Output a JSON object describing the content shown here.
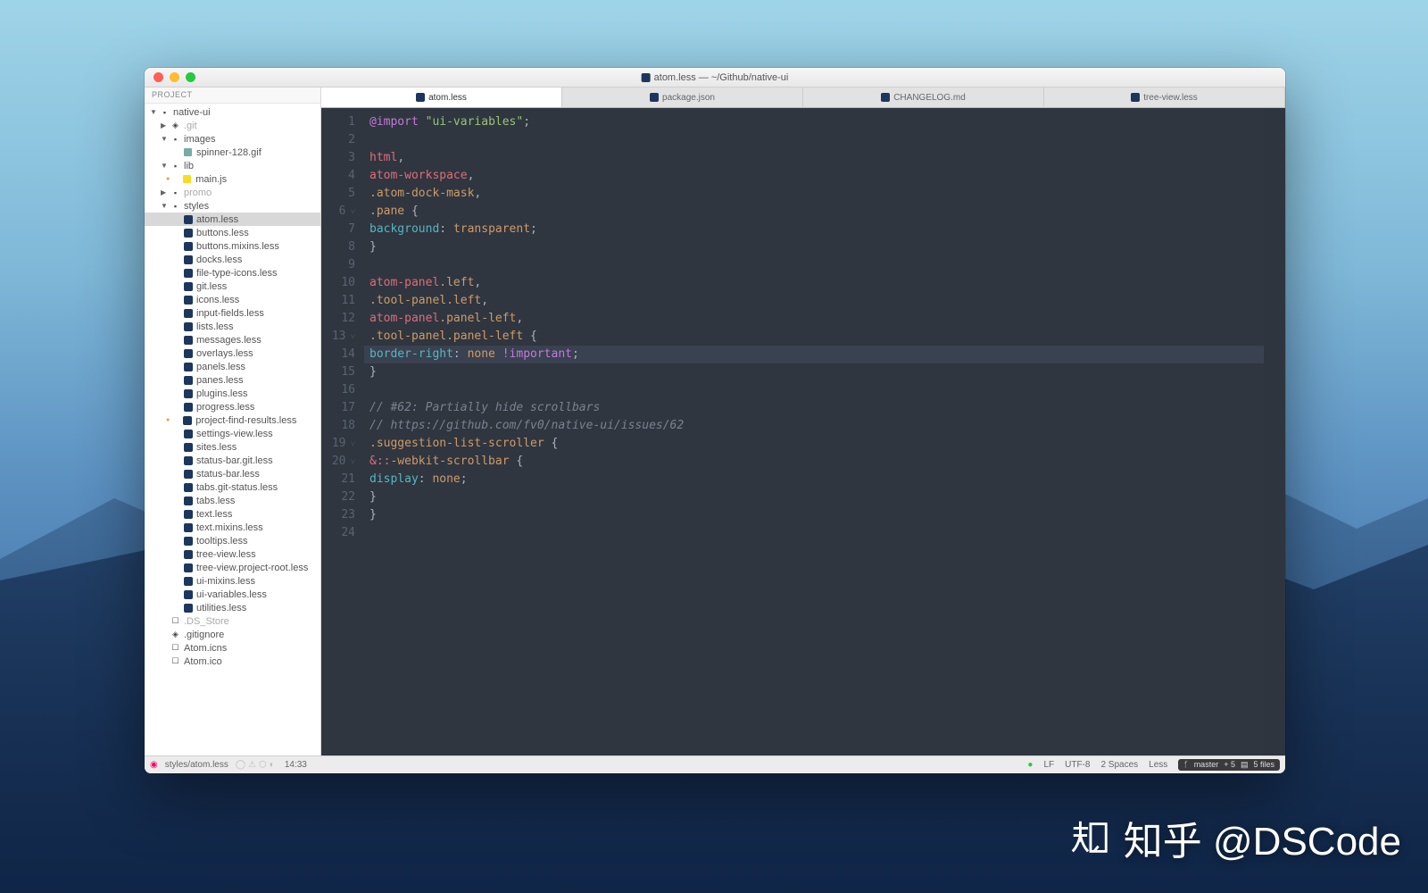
{
  "titlebar": {
    "title": "atom.less — ~/Github/native-ui"
  },
  "sidebar": {
    "header": "PROJECT",
    "tree": [
      {
        "lbl": "native-ui",
        "depth": 0,
        "exp": true,
        "kind": "folder"
      },
      {
        "lbl": ".git",
        "depth": 1,
        "exp": false,
        "kind": "git",
        "faded": true
      },
      {
        "lbl": "images",
        "depth": 1,
        "exp": true,
        "kind": "folder"
      },
      {
        "lbl": "spinner-128.gif",
        "depth": 2,
        "kind": "image"
      },
      {
        "lbl": "lib",
        "depth": 1,
        "exp": true,
        "kind": "folder"
      },
      {
        "lbl": "main.js",
        "depth": 2,
        "kind": "js",
        "mod": true
      },
      {
        "lbl": "promo",
        "depth": 1,
        "exp": false,
        "kind": "folder",
        "faded": true
      },
      {
        "lbl": "styles",
        "depth": 1,
        "exp": true,
        "kind": "folder"
      },
      {
        "lbl": "atom.less",
        "depth": 2,
        "kind": "less",
        "selected": true
      },
      {
        "lbl": "buttons.less",
        "depth": 2,
        "kind": "less"
      },
      {
        "lbl": "buttons.mixins.less",
        "depth": 2,
        "kind": "less"
      },
      {
        "lbl": "docks.less",
        "depth": 2,
        "kind": "less"
      },
      {
        "lbl": "file-type-icons.less",
        "depth": 2,
        "kind": "less"
      },
      {
        "lbl": "git.less",
        "depth": 2,
        "kind": "less"
      },
      {
        "lbl": "icons.less",
        "depth": 2,
        "kind": "less"
      },
      {
        "lbl": "input-fields.less",
        "depth": 2,
        "kind": "less"
      },
      {
        "lbl": "lists.less",
        "depth": 2,
        "kind": "less"
      },
      {
        "lbl": "messages.less",
        "depth": 2,
        "kind": "less"
      },
      {
        "lbl": "overlays.less",
        "depth": 2,
        "kind": "less"
      },
      {
        "lbl": "panels.less",
        "depth": 2,
        "kind": "less"
      },
      {
        "lbl": "panes.less",
        "depth": 2,
        "kind": "less"
      },
      {
        "lbl": "plugins.less",
        "depth": 2,
        "kind": "less"
      },
      {
        "lbl": "progress.less",
        "depth": 2,
        "kind": "less"
      },
      {
        "lbl": "project-find-results.less",
        "depth": 2,
        "kind": "less",
        "mod": true
      },
      {
        "lbl": "settings-view.less",
        "depth": 2,
        "kind": "less"
      },
      {
        "lbl": "sites.less",
        "depth": 2,
        "kind": "less"
      },
      {
        "lbl": "status-bar.git.less",
        "depth": 2,
        "kind": "less"
      },
      {
        "lbl": "status-bar.less",
        "depth": 2,
        "kind": "less"
      },
      {
        "lbl": "tabs.git-status.less",
        "depth": 2,
        "kind": "less"
      },
      {
        "lbl": "tabs.less",
        "depth": 2,
        "kind": "less"
      },
      {
        "lbl": "text.less",
        "depth": 2,
        "kind": "less"
      },
      {
        "lbl": "text.mixins.less",
        "depth": 2,
        "kind": "less"
      },
      {
        "lbl": "tooltips.less",
        "depth": 2,
        "kind": "less"
      },
      {
        "lbl": "tree-view.less",
        "depth": 2,
        "kind": "less"
      },
      {
        "lbl": "tree-view.project-root.less",
        "depth": 2,
        "kind": "less"
      },
      {
        "lbl": "ui-mixins.less",
        "depth": 2,
        "kind": "less"
      },
      {
        "lbl": "ui-variables.less",
        "depth": 2,
        "kind": "less"
      },
      {
        "lbl": "utilities.less",
        "depth": 2,
        "kind": "less"
      },
      {
        "lbl": ".DS_Store",
        "depth": 1,
        "kind": "file",
        "faded": true
      },
      {
        "lbl": ".gitignore",
        "depth": 1,
        "kind": "git"
      },
      {
        "lbl": "Atom.icns",
        "depth": 1,
        "kind": "file"
      },
      {
        "lbl": "Atom.ico",
        "depth": 1,
        "kind": "file"
      }
    ]
  },
  "tabs": [
    {
      "label": "atom.less",
      "active": true,
      "icon": "less"
    },
    {
      "label": "package.json",
      "active": false,
      "icon": "json"
    },
    {
      "label": "CHANGELOG.md",
      "active": false,
      "icon": "md"
    },
    {
      "label": "tree-view.less",
      "active": false,
      "icon": "less"
    }
  ],
  "code": {
    "highlight_line": 14,
    "fold_lines": [
      6,
      13,
      19,
      20
    ],
    "lines": [
      [
        {
          "t": "@import",
          "c": "kw"
        },
        {
          "t": " ",
          "c": "pn"
        },
        {
          "t": "\"ui-variables\"",
          "c": "str"
        },
        {
          "t": ";",
          "c": "pn"
        }
      ],
      [],
      [
        {
          "t": "html",
          "c": "tag"
        },
        {
          "t": ",",
          "c": "pn"
        }
      ],
      [
        {
          "t": "atom-workspace",
          "c": "tag"
        },
        {
          "t": ",",
          "c": "pn"
        }
      ],
      [
        {
          "t": ".atom-dock-mask",
          "c": "cls"
        },
        {
          "t": ",",
          "c": "pn"
        }
      ],
      [
        {
          "t": ".pane",
          "c": "cls"
        },
        {
          "t": " {",
          "c": "pn"
        }
      ],
      [
        {
          "t": "  background",
          "c": "prop"
        },
        {
          "t": ": ",
          "c": "pn"
        },
        {
          "t": "transparent",
          "c": "val"
        },
        {
          "t": ";",
          "c": "pn"
        }
      ],
      [
        {
          "t": "}",
          "c": "pn"
        }
      ],
      [],
      [
        {
          "t": "atom-panel",
          "c": "tag"
        },
        {
          "t": ".left",
          "c": "cls"
        },
        {
          "t": ",",
          "c": "pn"
        }
      ],
      [
        {
          "t": ".tool-panel",
          "c": "cls"
        },
        {
          "t": ".left",
          "c": "cls"
        },
        {
          "t": ",",
          "c": "pn"
        }
      ],
      [
        {
          "t": "atom-panel",
          "c": "tag"
        },
        {
          "t": ".panel-left",
          "c": "cls"
        },
        {
          "t": ",",
          "c": "pn"
        }
      ],
      [
        {
          "t": ".tool-panel",
          "c": "cls"
        },
        {
          "t": ".panel-left",
          "c": "cls"
        },
        {
          "t": " {",
          "c": "pn"
        }
      ],
      [
        {
          "t": "  border-right",
          "c": "prop"
        },
        {
          "t": ": ",
          "c": "pn"
        },
        {
          "t": "none",
          "c": "val"
        },
        {
          "t": " !important",
          "c": "imp"
        },
        {
          "t": ";",
          "c": "pn"
        }
      ],
      [
        {
          "t": "}",
          "c": "pn"
        }
      ],
      [],
      [
        {
          "t": "// #62: Partially hide scrollbars",
          "c": "cm"
        }
      ],
      [
        {
          "t": "// https://github.com/fv0/native-ui/issues/62",
          "c": "cm"
        }
      ],
      [
        {
          "t": ".suggestion-list-scroller",
          "c": "cls"
        },
        {
          "t": " {",
          "c": "pn"
        }
      ],
      [
        {
          "t": "  &::",
          "c": "tag"
        },
        {
          "t": "-webkit-scrollbar",
          "c": "cls"
        },
        {
          "t": " {",
          "c": "pn"
        }
      ],
      [
        {
          "t": "    display",
          "c": "prop"
        },
        {
          "t": ": ",
          "c": "pn"
        },
        {
          "t": "none",
          "c": "val"
        },
        {
          "t": ";",
          "c": "pn"
        }
      ],
      [
        {
          "t": "  }",
          "c": "pn"
        }
      ],
      [
        {
          "t": "}",
          "c": "pn"
        }
      ],
      []
    ]
  },
  "statusbar": {
    "path": "styles/atom.less",
    "cursor": "14:33",
    "dot": "●",
    "eol": "LF",
    "encoding": "UTF-8",
    "indent": "2 Spaces",
    "lang": "Less",
    "git_branch": "master",
    "git_stats": "+ 5",
    "git_files": "5 files"
  },
  "watermark": "知乎 @DSCode"
}
